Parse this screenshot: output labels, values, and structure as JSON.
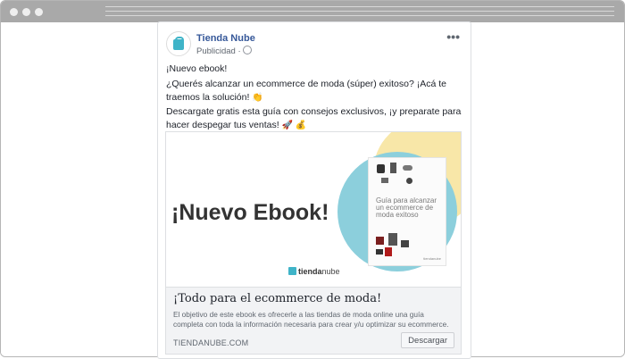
{
  "post": {
    "page_name": "Tienda Nube",
    "sponsored": "Publicidad ·",
    "more": "•••",
    "text1": "¡Nuevo ebook!",
    "text2": "¿Querés alcanzar un ecommerce de moda (súper) exitoso? ¡Acá te traemos la solución!",
    "text2_emoji": "👏",
    "text3": "Descargate gratis esta guía con consejos exclusivos, ¡y preparate para hacer despegar tus ventas!",
    "text3_emoji": "🚀 💰"
  },
  "media": {
    "headline": "¡Nuevo Ebook!",
    "book_title": "Guía para alcanzar un ecommerce de moda exitoso",
    "book_brand": "tiendanube",
    "logo_bold": "tienda",
    "logo_rest": "nube"
  },
  "link": {
    "headline": "¡Todo para el ecommerce de moda!",
    "description": "El objetivo de este ebook es ofrecerle a las tiendas de moda online una guía completa con toda la información necesaria para crear y/u optimizar su ecommerce.",
    "domain": "TIENDANUBE.COM",
    "cta": "Descargar"
  }
}
